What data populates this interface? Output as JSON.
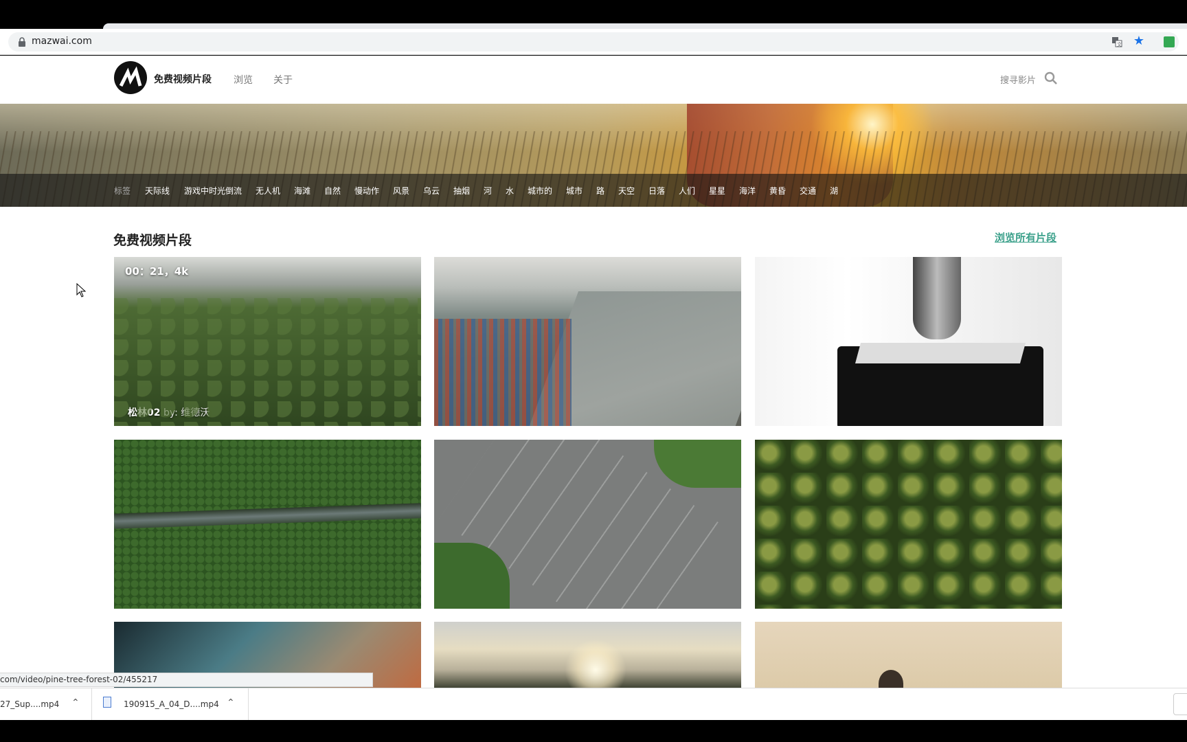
{
  "browser": {
    "url": "mazwai.com",
    "status_url": "com/video/pine-tree-forest-02/455217"
  },
  "header": {
    "brand": "免费视频片段",
    "nav": [
      "浏览",
      "关于"
    ],
    "search_label": "搜寻影片"
  },
  "tags": {
    "lead": "标签",
    "items": [
      "天际线",
      "游戏中时光倒流",
      "无人机",
      "海滩",
      "自然",
      "慢动作",
      "风景",
      "乌云",
      "抽烟",
      "河",
      "水",
      "城市的",
      "城市",
      "路",
      "天空",
      "日落",
      "人们",
      "星星",
      "海洋",
      "黄昏",
      "交通",
      "湖"
    ]
  },
  "section": {
    "title": "免费视频片段",
    "browse_all": "浏览所有片段"
  },
  "videos": {
    "first": {
      "meta": "00：21，4k",
      "title": "松林02",
      "by": "by: 维德沃"
    }
  },
  "downloads": [
    {
      "name": "27_Sup....mp4"
    },
    {
      "name": "190915_A_04_D....mp4"
    }
  ],
  "colors": {
    "accent": "#3aa08a",
    "star": "#1a73e8"
  }
}
